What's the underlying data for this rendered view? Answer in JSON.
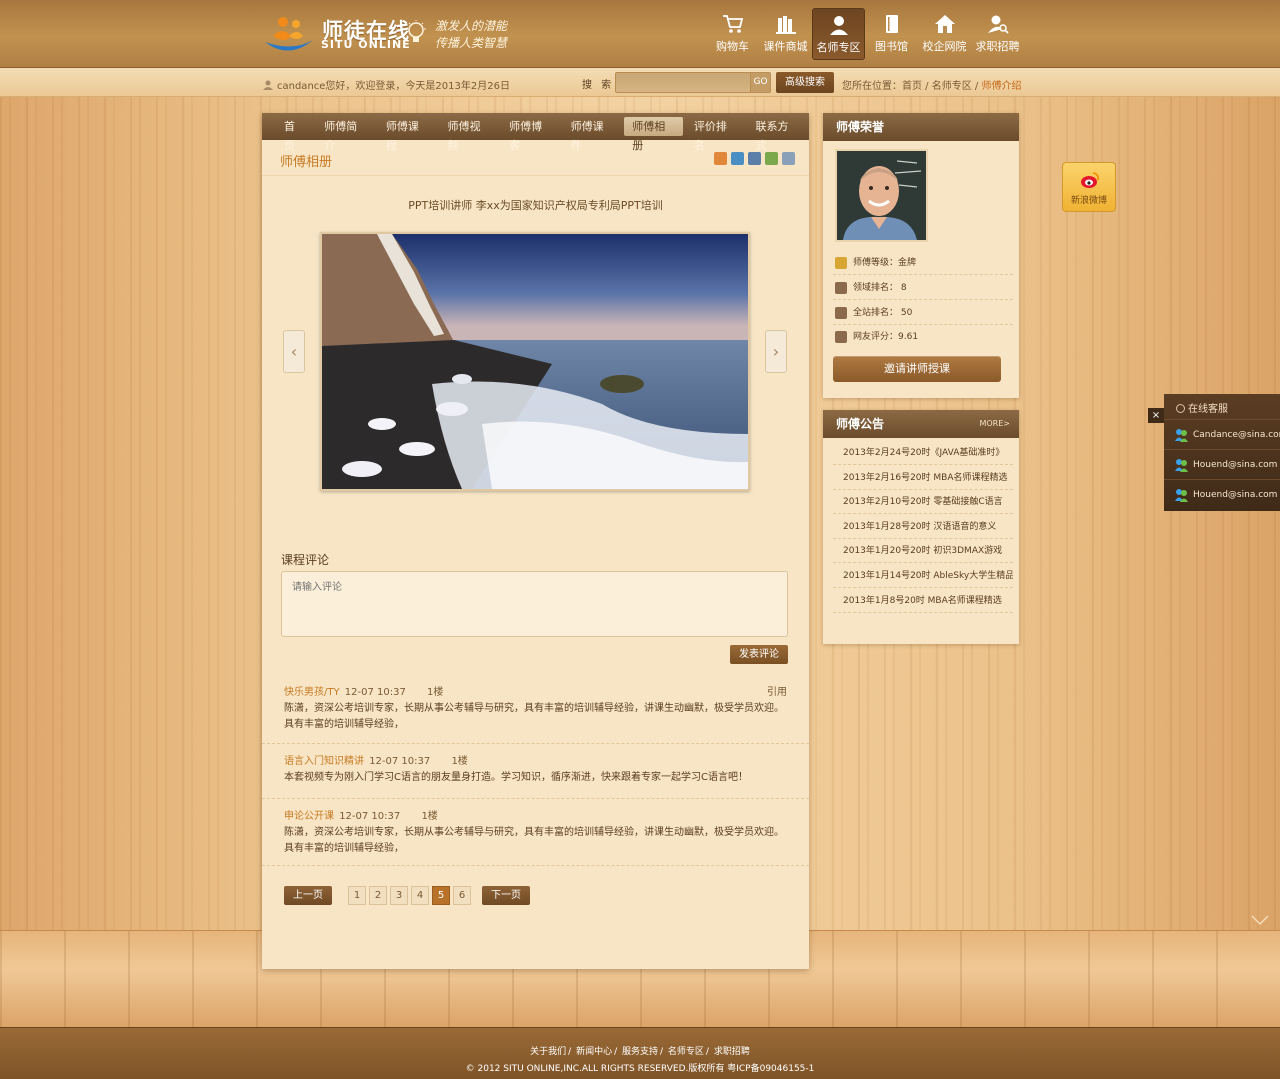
{
  "header": {
    "logo_cn": "师徒在线",
    "logo_en": "SITU ONLINE",
    "slogan_line1": "激发人的潜能",
    "slogan_line2": "传播人类智慧",
    "nav": [
      {
        "label": "购物车",
        "icon": "cart-icon"
      },
      {
        "label": "课件商城",
        "icon": "books-icon"
      },
      {
        "label": "名师专区",
        "icon": "teacher-icon",
        "active": true
      },
      {
        "label": "图书馆",
        "icon": "book-icon"
      },
      {
        "label": "校企网院",
        "icon": "house-icon"
      },
      {
        "label": "求职招聘",
        "icon": "user-search-icon"
      }
    ]
  },
  "subbar": {
    "welcome": "candance您好，欢迎登录，今天是2013年2月26日",
    "search_label": "搜 索",
    "search_value": "",
    "go_label": "GO",
    "advanced_label": "高级搜索",
    "crumb_prefix": "您所在位置：",
    "crumb": [
      "首页",
      "名师专区",
      "师傅介绍"
    ],
    "crumb_sep": " / "
  },
  "main": {
    "tabs": [
      "首页",
      "师傅简介",
      "师傅课程",
      "师傅视频",
      "师傅博客",
      "师傅课件",
      "师傅相册",
      "评价排名",
      "联系方式"
    ],
    "active_tab": "师傅相册",
    "album_title": "师傅相册",
    "photo_caption": "PPT培训讲师 李xx为国家知识产权局专利局PPT培训",
    "prev_arrow": "‹",
    "next_arrow": "›",
    "comment_title": "课程评论",
    "comment_placeholder": "请输入评论",
    "post_label": "发表评论",
    "reply_label": "引用",
    "comments": [
      {
        "user": "快乐男孩/TY",
        "time": "12-07 10:37",
        "floor": "1楼",
        "body": "陈潇，资深公考培训专家，长期从事公考辅导与研究，具有丰富的培训辅导经验，讲课生动幽默，极受学员欢迎。具有丰富的培训辅导经验，",
        "show_reply": true
      },
      {
        "user": "语言入门知识精讲",
        "time": "12-07 10:37",
        "floor": "1楼",
        "body": "本套视频专为刚入门学习C语言的朋友量身打造。学习知识，循序渐进，快来跟着专家一起学习C语言吧！",
        "show_reply": false
      },
      {
        "user": "申论公开课",
        "time": "12-07 10:37",
        "floor": "1楼",
        "body": "陈潇，资深公考培训专家，长期从事公考辅导与研究，具有丰富的培训辅导经验，讲课生动幽默，极受学员欢迎。具有丰富的培训辅导经验，",
        "show_reply": false
      }
    ],
    "pager": {
      "prev": "上一页",
      "next": "下一页",
      "pages": [
        "1",
        "2",
        "3",
        "4",
        "5",
        "6"
      ],
      "current": "5"
    }
  },
  "honor": {
    "title": "师傅荣誉",
    "rows": [
      {
        "label": "师傅等级：金牌",
        "icon": "trophy-icon"
      },
      {
        "label": "领域排名： 8",
        "icon": "medal-icon"
      },
      {
        "label": "全站排名： 50",
        "icon": "thumb-up-icon"
      },
      {
        "label": "网友评分：9.61",
        "icon": "rating-icon"
      }
    ],
    "invite_label": "邀请讲师授课"
  },
  "notice": {
    "title": "师傅公告",
    "more": "MORE>",
    "items": [
      "2013年2月24号20时《JAVA基础准时》",
      "2013年2月16号20时 MBA名师课程精选",
      "2013年2月10号20时 零基础接触C语言",
      "2013年1月28号20时 汉语语音的意义",
      "2013年1月20号20时 初识3DMAX游戏",
      "2013年1月14号20时 AbleSky大学生精品",
      "2013年1月8号20时 MBA名师课程精选"
    ]
  },
  "weibo": {
    "label": "新浪微博"
  },
  "kefu": {
    "title": "在线客服",
    "close": "×",
    "contacts": [
      "Candance@sina.com",
      "Houend@sina.com",
      "Houend@sina.com"
    ]
  },
  "footer": {
    "links": [
      "关于我们",
      "新闻中心",
      "服务支持",
      "名师专区",
      "求职招聘"
    ],
    "copyright": "© 2012 SITU ONLINE,INC.ALL RIGHTS RESERVED.版权所有 粤ICP备09046155-1"
  },
  "colors": {
    "accent": "#c77b23",
    "brown_dark": "#6a4b2b",
    "panel": "#f7e5c5"
  }
}
